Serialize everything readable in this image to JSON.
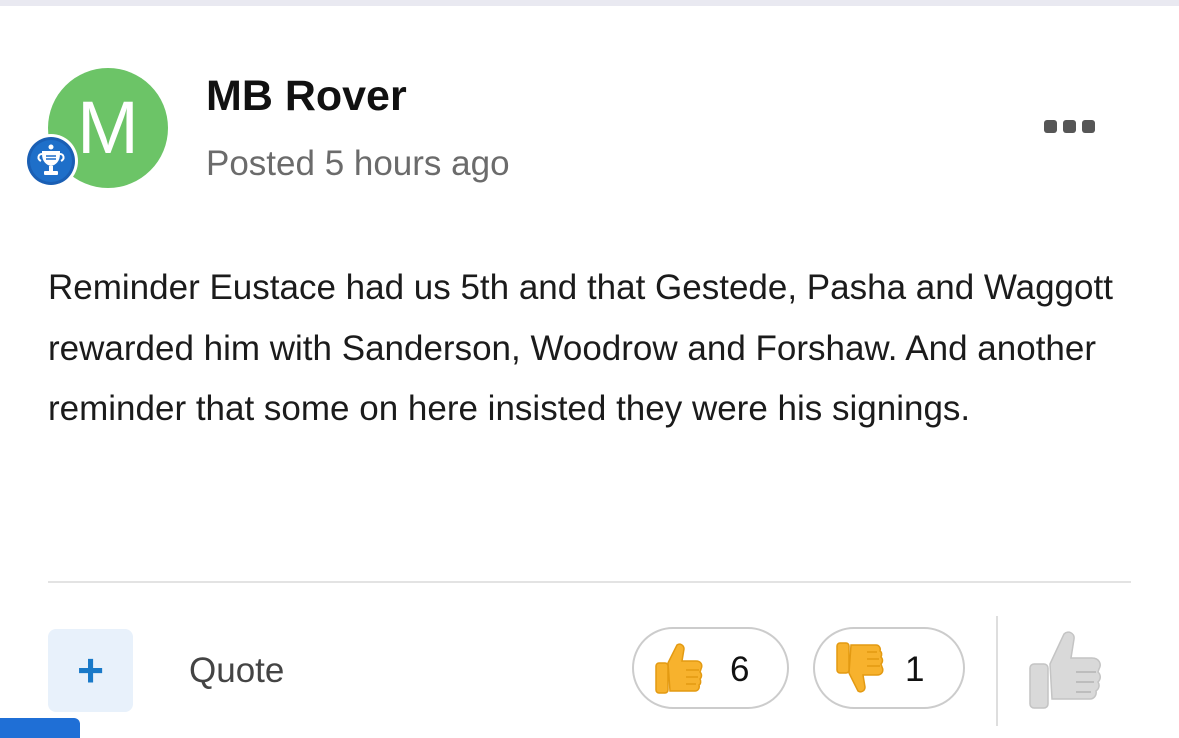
{
  "post": {
    "avatar_letter": "M",
    "author": "MB Rover",
    "posted": "Posted 5 hours ago",
    "body": "Reminder Eustace had us 5th and that Gestede, Pasha and Waggott rewarded him with Sanderson, Woodrow and Forshaw. And another reminder that some on here insisted they were his signings."
  },
  "actions": {
    "multiquote_symbol": "+",
    "quote_label": "Quote",
    "thumbs_up_count": "6",
    "thumbs_down_count": "1"
  },
  "icons": {
    "badge": "trophy-badge-icon",
    "more": "ellipsis-icon",
    "thumbs_up": "thumbs-up-emoji",
    "thumbs_down": "thumbs-down-emoji",
    "react": "thumbs-up-outline-icon"
  },
  "colors": {
    "avatar": "#6cc467",
    "accent": "#1979c8",
    "emoji": "#f7b22d"
  }
}
